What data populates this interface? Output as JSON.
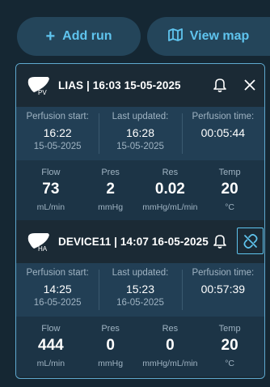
{
  "toolbar": {
    "add_run_label": "Add run",
    "view_map_label": "View map"
  },
  "runs": [
    {
      "organ_tag": "PV",
      "title": "LIAS | 16:03 15-05-2025",
      "perfusion_start_label": "Perfusion start:",
      "perfusion_start_time": "16:22",
      "perfusion_start_date": "15-05-2025",
      "last_updated_label": "Last updated:",
      "last_updated_time": "16:28",
      "last_updated_date": "15-05-2025",
      "perfusion_time_label": "Perfusion time:",
      "perfusion_time_value": "00:05:44",
      "metrics": [
        {
          "label": "Flow",
          "value": "73",
          "unit": "mL/min"
        },
        {
          "label": "Pres",
          "value": "2",
          "unit": "mmHg"
        },
        {
          "label": "Res",
          "value": "0.02",
          "unit": "mmHg/mL/min"
        },
        {
          "label": "Temp",
          "value": "20",
          "unit": "°C"
        }
      ]
    },
    {
      "organ_tag": "HA",
      "title": "DEVICE11 | 14:07 16-05-2025",
      "perfusion_start_label": "Perfusion start:",
      "perfusion_start_time": "14:25",
      "perfusion_start_date": "16-05-2025",
      "last_updated_label": "Last updated:",
      "last_updated_time": "15:23",
      "last_updated_date": "16-05-2025",
      "perfusion_time_label": "Perfusion time:",
      "perfusion_time_value": "00:57:39",
      "metrics": [
        {
          "label": "Flow",
          "value": "444",
          "unit": "mL/min"
        },
        {
          "label": "Pres",
          "value": "0",
          "unit": "mmHg"
        },
        {
          "label": "Res",
          "value": "0",
          "unit": "mmHg/mL/min"
        },
        {
          "label": "Temp",
          "value": "20",
          "unit": "°C"
        }
      ]
    }
  ],
  "colors": {
    "background": "#152733",
    "accent": "#5fc4ee",
    "pill": "#24455a"
  }
}
